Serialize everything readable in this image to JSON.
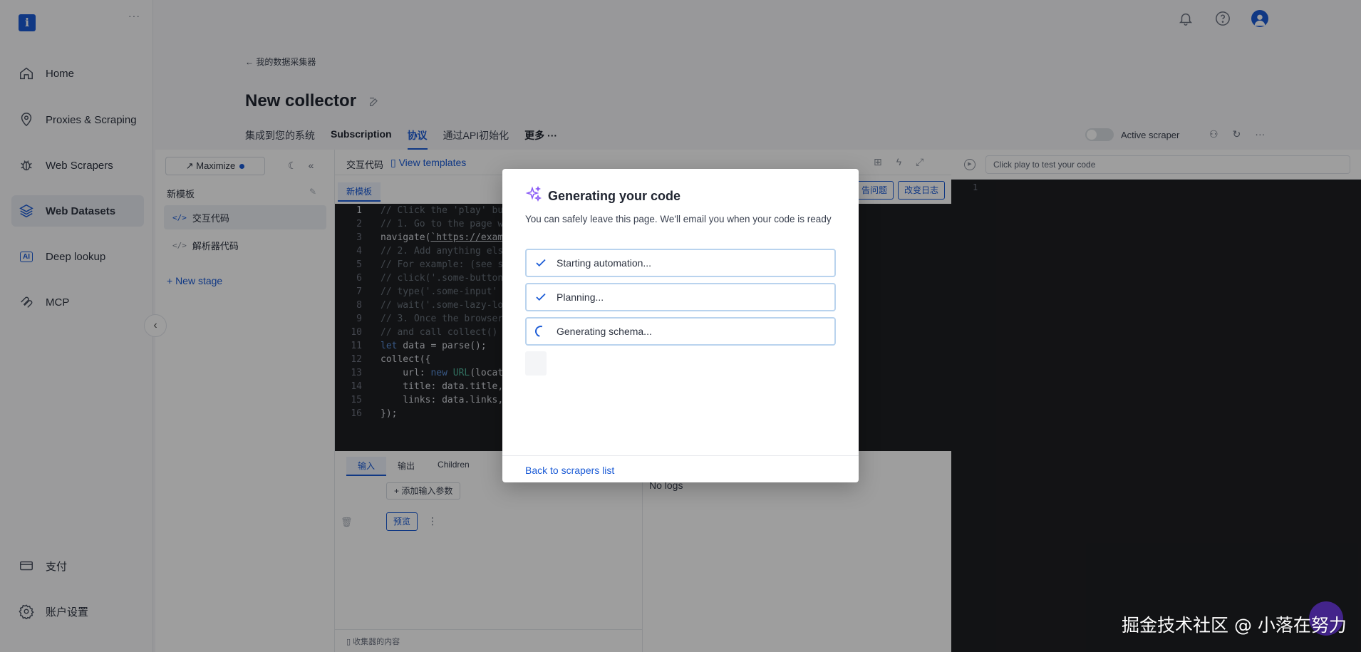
{
  "sidebar": {
    "logo": "i",
    "menu_dots": "···",
    "items": [
      {
        "label": "Home",
        "icon": "home-icon"
      },
      {
        "label": "Proxies & Scraping",
        "icon": "location-pin-icon"
      },
      {
        "label": "Web Scrapers",
        "icon": "bug-icon"
      },
      {
        "label": "Web Datasets",
        "icon": "layers-icon",
        "active": true
      },
      {
        "label": "Deep lookup",
        "icon": "ai-icon",
        "badge": "AI"
      },
      {
        "label": "MCP",
        "icon": "mcp-icon"
      },
      {
        "label": "支付",
        "icon": "card-icon"
      },
      {
        "label": "账户设置",
        "icon": "gear-icon"
      }
    ],
    "collapse_glyph": "‹"
  },
  "topbar": {
    "icons": [
      "bell-icon",
      "help-icon",
      "avatar"
    ]
  },
  "header": {
    "breadcrumb": "← 我的数据采集器",
    "title": "New collector",
    "tabs": [
      {
        "label": "集成到您的系统"
      },
      {
        "label": "Subscription",
        "strong": true
      },
      {
        "label": "协议",
        "active": true
      },
      {
        "label": "通过API初始化"
      },
      {
        "label": "更多 ···",
        "strong": true
      }
    ],
    "active_scraper_label": "Active scraper"
  },
  "stages": {
    "maximize_label": "↗ Maximize",
    "template_label": "新模板",
    "items": [
      {
        "label": "交互代码",
        "active": true
      },
      {
        "label": "解析器代码"
      }
    ],
    "new_stage_label": "+ New stage"
  },
  "editor": {
    "title": "交互代码",
    "view_templates": "View templates",
    "sub_tab": "新模板",
    "report_button": "告问题",
    "changelog_button": "改变日志",
    "lines": [
      {
        "n": "1",
        "parts": [
          [
            "c-com",
            "// Click the 'play' bu"
          ]
        ]
      },
      {
        "n": "2",
        "parts": [
          [
            "c-com",
            "// 1. Go to the page w"
          ]
        ]
      },
      {
        "n": "3",
        "parts": [
          [
            "c-txt",
            "navigate("
          ],
          [
            "c-str",
            "`https://exam"
          ]
        ]
      },
      {
        "n": "4",
        "parts": [
          [
            "c-com",
            "// 2. Add anything els"
          ]
        ]
      },
      {
        "n": "5",
        "parts": [
          [
            "c-com",
            "// For example: (see s"
          ]
        ]
      },
      {
        "n": "6",
        "parts": [
          [
            "c-com",
            "// click('.some-button"
          ]
        ]
      },
      {
        "n": "7",
        "parts": [
          [
            "c-com",
            "// type('.some-input'"
          ]
        ]
      },
      {
        "n": "8",
        "parts": [
          [
            "c-com",
            "// wait('.some-lazy-lo"
          ]
        ]
      },
      {
        "n": "9",
        "parts": [
          [
            "c-com",
            "// 3. Once the browser"
          ]
        ]
      },
      {
        "n": "10",
        "parts": [
          [
            "c-com",
            "// and call collect()"
          ]
        ]
      },
      {
        "n": "11",
        "parts": [
          [
            "c-kw",
            "let"
          ],
          [
            "c-txt",
            " data = parse();"
          ]
        ]
      },
      {
        "n": "12",
        "parts": [
          [
            "c-txt",
            "collect({"
          ]
        ]
      },
      {
        "n": "13",
        "parts": [
          [
            "c-txt",
            "    url: "
          ],
          [
            "c-kw",
            "new"
          ],
          [
            "c-txt",
            " "
          ],
          [
            "c-fn",
            "URL"
          ],
          [
            "c-txt",
            "(locat"
          ]
        ]
      },
      {
        "n": "14",
        "parts": [
          [
            "c-txt",
            "    title: data.title,"
          ]
        ]
      },
      {
        "n": "15",
        "parts": [
          [
            "c-txt",
            "    links: data.links,"
          ]
        ]
      },
      {
        "n": "16",
        "parts": [
          [
            "c-txt",
            "});"
          ]
        ]
      }
    ]
  },
  "io_panel": {
    "tabs": [
      "输入",
      "输出",
      "Children"
    ],
    "add_param": "+ 添加输入参数",
    "preview": "预览",
    "footer": "▯ 收集器的内容"
  },
  "logs": {
    "empty": "No logs"
  },
  "runner": {
    "placeholder": "Click play to test your code",
    "line": "1"
  },
  "modal": {
    "title": "Generating your code",
    "description": "You can safely leave this page. We'll email you when your code is ready",
    "steps": [
      {
        "label": "Starting automation...",
        "status": "done"
      },
      {
        "label": "Planning...",
        "status": "done"
      },
      {
        "label": "Generating schema...",
        "status": "loading"
      }
    ],
    "back_link": "Back to scrapers list"
  },
  "watermark": "掘金技术社区 @ 小落在努力",
  "colors": {
    "accent": "#1b5bd6",
    "sparkle": "#8b5cf6",
    "step_border": "#b9d3ee"
  }
}
